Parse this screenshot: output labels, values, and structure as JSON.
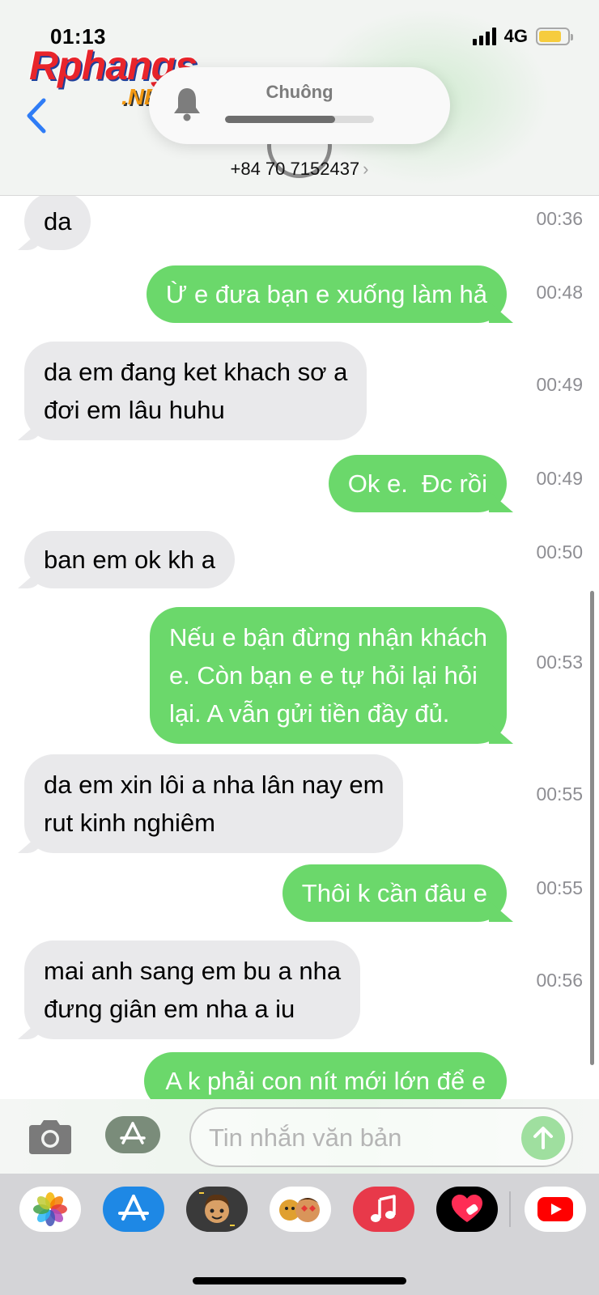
{
  "status_bar": {
    "time": "01:13",
    "network": "4G"
  },
  "watermark": {
    "logo_main": "Rphangs",
    "logo_suffix": ".NET"
  },
  "header": {
    "ringer_label": "Chuông",
    "ringer_volume_fraction": 0.74,
    "contact_number": "+84 70 7152437",
    "chevron": "›"
  },
  "messages": [
    {
      "direction": "in",
      "text": "da",
      "time": "00:36"
    },
    {
      "direction": "out",
      "text": "Ừ e đưa bạn e xuống làm hả",
      "time": "00:48"
    },
    {
      "direction": "in",
      "text": "da em đang ket khach sơ a\nđơi em lâu huhu",
      "time": "00:49"
    },
    {
      "direction": "out",
      "text": "Ok e.  Đc rồi",
      "time": "00:49"
    },
    {
      "direction": "in",
      "text": "ban em ok kh a",
      "time": "00:50"
    },
    {
      "direction": "out",
      "text": "Nếu e bận đừng nhận khách\ne. Còn bạn e e tự hỏi lại hỏi\nlại. A vẫn gửi tiền đầy đủ.",
      "time": "00:53"
    },
    {
      "direction": "in",
      "text": "da em xin lôi a nha lân nay em\nrut kinh nghiêm",
      "time": "00:55"
    },
    {
      "direction": "out",
      "text": "Thôi k cần đâu e",
      "time": "00:55"
    },
    {
      "direction": "in",
      "text": "mai anh sang em bu a nha\nđưng giân em nha a iu",
      "time": "00:56"
    },
    {
      "direction": "out",
      "text": "A k phải con nít mới lớn để e",
      "time": ""
    }
  ],
  "composer": {
    "placeholder": "Tin nhắn văn bản",
    "camera_icon": "camera-icon",
    "apps_icon": "app-store-icon",
    "send_icon": "arrow-up-icon"
  },
  "dock_apps": [
    "photos",
    "app-store",
    "memoji",
    "animoji-stickers",
    "music",
    "digital-touch",
    "youtube"
  ],
  "colors": {
    "outgoing_bubble": "#6bd86b",
    "incoming_bubble": "#e9e9eb",
    "timestamp": "#8e8e93",
    "link_blue": "#2f7cf6",
    "battery": "#f6cc3e"
  }
}
